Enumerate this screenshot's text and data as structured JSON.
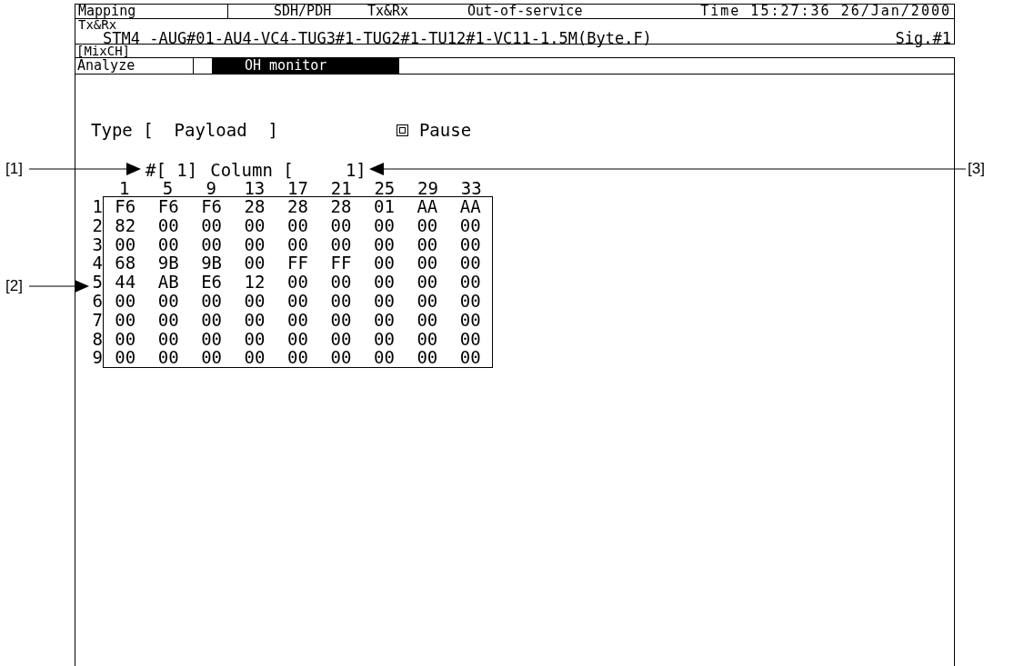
{
  "status_bar": {
    "mode": "Mapping",
    "interface": "SDH/PDH",
    "direction": "Tx&Rx",
    "state": "Out-of-service",
    "time": "Time 15:27:36 26/Jan/2000"
  },
  "channel": {
    "label": "Tx&Rx",
    "path": "STM4 -AUG#01-AU4-VC4-TUG3#1-TUG2#1-TU12#1-VC11-1.5M(Byte.F)",
    "signal": "Sig.#1"
  },
  "mix_label": "[MixCH]",
  "tabs": [
    {
      "label": "Analyze",
      "selected": false
    },
    {
      "label": "OH monitor",
      "selected": true
    }
  ],
  "type_field": "Type [  Payload  ]",
  "pause": {
    "label": "Pause",
    "checked": true
  },
  "frame_field": "#[ 1]",
  "column_field": "Column [     1]",
  "table": {
    "columns": [
      "1",
      "5",
      "9",
      "13",
      "17",
      "21",
      "25",
      "29",
      "33"
    ],
    "rows": [
      {
        "label": "1",
        "cells": [
          "F6",
          "F6",
          "F6",
          "28",
          "28",
          "28",
          "01",
          "AA",
          "AA"
        ]
      },
      {
        "label": "2",
        "cells": [
          "82",
          "00",
          "00",
          "00",
          "00",
          "00",
          "00",
          "00",
          "00"
        ]
      },
      {
        "label": "3",
        "cells": [
          "00",
          "00",
          "00",
          "00",
          "00",
          "00",
          "00",
          "00",
          "00"
        ]
      },
      {
        "label": "4",
        "cells": [
          "68",
          "9B",
          "9B",
          "00",
          "FF",
          "FF",
          "00",
          "00",
          "00"
        ]
      },
      {
        "label": "5",
        "cells": [
          "44",
          "AB",
          "E6",
          "12",
          "00",
          "00",
          "00",
          "00",
          "00"
        ]
      },
      {
        "label": "6",
        "cells": [
          "00",
          "00",
          "00",
          "00",
          "00",
          "00",
          "00",
          "00",
          "00"
        ]
      },
      {
        "label": "7",
        "cells": [
          "00",
          "00",
          "00",
          "00",
          "00",
          "00",
          "00",
          "00",
          "00"
        ]
      },
      {
        "label": "8",
        "cells": [
          "00",
          "00",
          "00",
          "00",
          "00",
          "00",
          "00",
          "00",
          "00"
        ]
      },
      {
        "label": "9",
        "cells": [
          "00",
          "00",
          "00",
          "00",
          "00",
          "00",
          "00",
          "00",
          "00"
        ]
      }
    ]
  },
  "callouts": [
    {
      "label": "[1]"
    },
    {
      "label": "[2]"
    },
    {
      "label": "[3]"
    }
  ]
}
